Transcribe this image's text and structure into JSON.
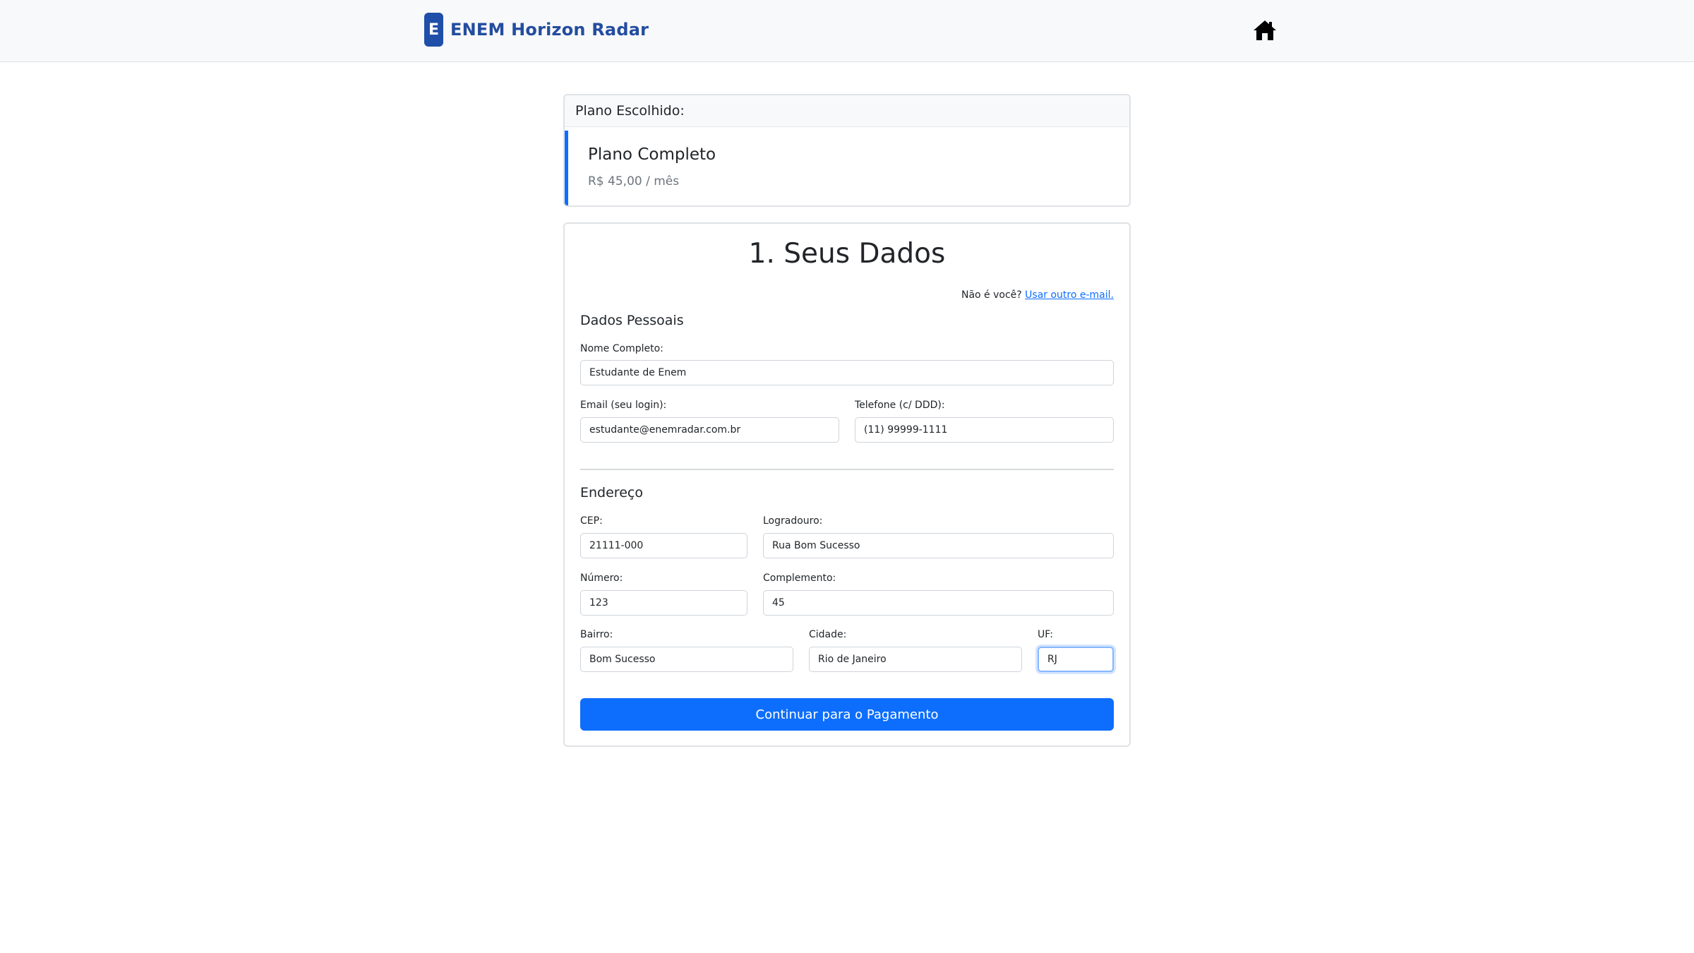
{
  "header": {
    "logo_letter": "E",
    "brand": "ENEM Horizon Radar",
    "home_icon": "home-icon"
  },
  "plan": {
    "header": "Plano Escolhido:",
    "name": "Plano Completo",
    "price": "R$ 45,00 / mês"
  },
  "form": {
    "title": "1. Seus Dados",
    "not_you_text": "Não é você?",
    "not_you_link": "Usar outro e-mail.",
    "personal_section": "Dados Pessoais",
    "address_section": "Endereço",
    "fields": {
      "nome": {
        "label": "Nome Completo:",
        "value": "Estudante de Enem"
      },
      "email": {
        "label": "Email (seu login):",
        "value": "estudante@enemradar.com.br"
      },
      "telefone": {
        "label": "Telefone (c/ DDD):",
        "value": "(11) 99999-1111"
      },
      "cep": {
        "label": "CEP:",
        "value": "21111-000"
      },
      "logradouro": {
        "label": "Logradouro:",
        "value": "Rua Bom Sucesso"
      },
      "numero": {
        "label": "Número:",
        "value": "123"
      },
      "complemento": {
        "label": "Complemento:",
        "value": "45"
      },
      "bairro": {
        "label": "Bairro:",
        "value": "Bom Sucesso"
      },
      "cidade": {
        "label": "Cidade:",
        "value": "Rio de Janeiro"
      },
      "uf": {
        "label": "UF:",
        "value": "RJ"
      }
    },
    "submit_label": "Continuar para o Pagamento"
  },
  "colors": {
    "primary": "#0d6efd",
    "brand": "#234d9f",
    "header_bg": "#f8f9fa",
    "muted": "#6c757d"
  }
}
